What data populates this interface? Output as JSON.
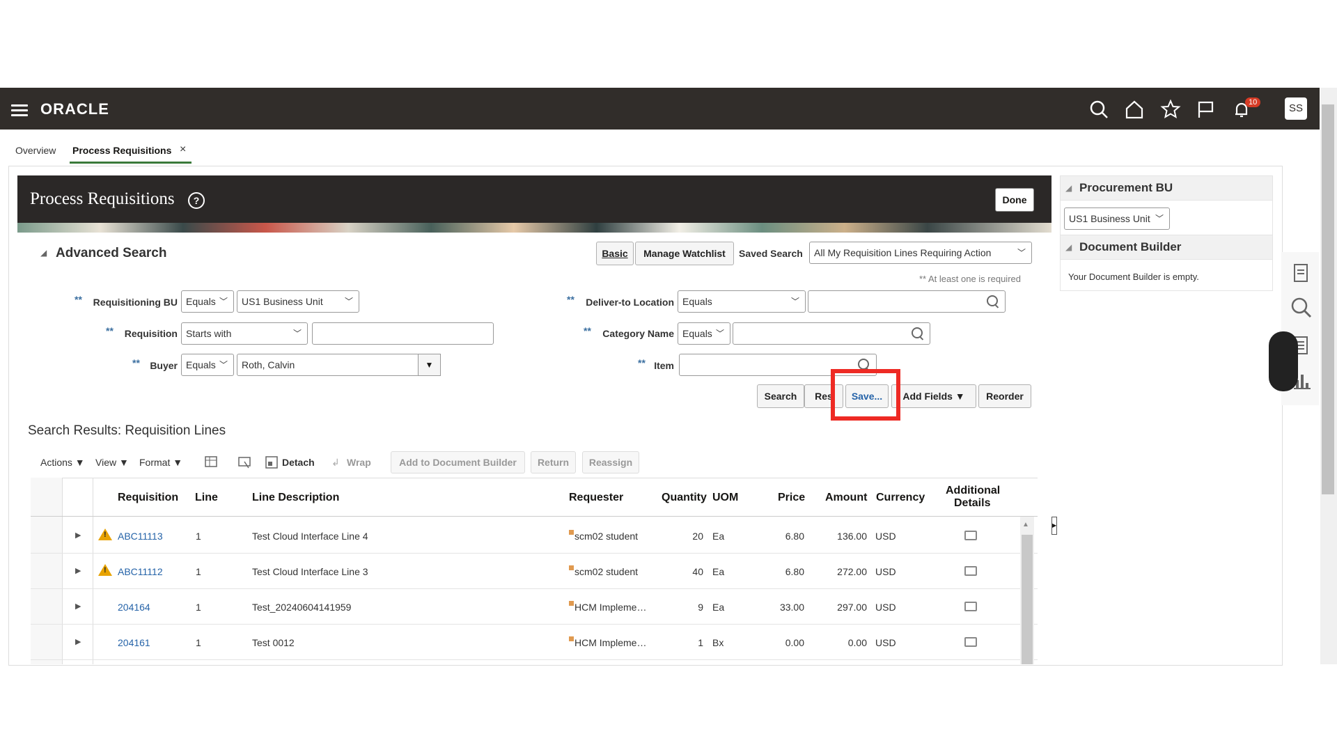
{
  "app": {
    "brand": "ORACLE",
    "user_initials": "SS",
    "notification_count": "10"
  },
  "tabs": [
    {
      "label": "Overview"
    },
    {
      "label": "Process Requisitions"
    }
  ],
  "header": {
    "title": "Process Requisitions",
    "done_label": "Done"
  },
  "advanced_search": {
    "title": "Advanced Search",
    "basic_label": "Basic",
    "watchlist_label": "Manage Watchlist",
    "saved_search_label": "Saved Search",
    "saved_search_value": "All My Requisition Lines Requiring Action",
    "required_note": "** At least one is required",
    "fields": {
      "req_bu": {
        "label": "Requisitioning BU",
        "operator": "Equals",
        "value": "US1 Business Unit"
      },
      "requisition": {
        "label": "Requisition",
        "operator": "Starts with",
        "value": ""
      },
      "buyer": {
        "label": "Buyer",
        "operator": "Equals",
        "value": "Roth, Calvin"
      },
      "deliver_to": {
        "label": "Deliver-to Location",
        "operator": "Equals",
        "value": ""
      },
      "category": {
        "label": "Category Name",
        "operator": "Equals",
        "value": ""
      },
      "item": {
        "label": "Item",
        "value": ""
      }
    },
    "required_marker": "**",
    "buttons": {
      "search": "Search",
      "reset": "Res",
      "save": "Save...",
      "add_fields": "Add Fields",
      "reorder": "Reorder"
    }
  },
  "results": {
    "title": "Search Results: Requisition Lines",
    "toolbar": {
      "actions": "Actions",
      "view": "View",
      "format": "Format",
      "detach": "Detach",
      "wrap": "Wrap",
      "add_doc": "Add to Document Builder",
      "return": "Return",
      "reassign": "Reassign"
    },
    "columns": [
      "Requisition",
      "Line",
      "Line Description",
      "Requester",
      "Quantity",
      "UOM",
      "Price",
      "Amount",
      "Currency",
      "Additional",
      "Details"
    ],
    "rows": [
      {
        "requisition": "ABC11113",
        "line": "1",
        "description": "Test Cloud Interface Line 4",
        "requester": "scm02 student",
        "quantity": "20",
        "uom": "Ea",
        "price": "6.80",
        "amount": "136.00",
        "currency": "USD"
      },
      {
        "requisition": "ABC11112",
        "line": "1",
        "description": "Test Cloud Interface Line 3",
        "requester": "scm02 student",
        "quantity": "40",
        "uom": "Ea",
        "price": "6.80",
        "amount": "272.00",
        "currency": "USD"
      },
      {
        "requisition": "204164",
        "line": "1",
        "description": "Test_20240604141959",
        "requester": "HCM Impleme…",
        "quantity": "9",
        "uom": "Ea",
        "price": "33.00",
        "amount": "297.00",
        "currency": "USD"
      },
      {
        "requisition": "204161",
        "line": "1",
        "description": "Test 0012",
        "requester": "HCM Impleme…",
        "quantity": "1",
        "uom": "Bx",
        "price": "0.00",
        "amount": "0.00",
        "currency": "USD"
      }
    ]
  },
  "right_panel": {
    "procurement_bu_title": "Procurement BU",
    "procurement_bu_value": "US1 Business Unit",
    "doc_builder_title": "Document Builder",
    "doc_builder_empty": "Your Document Builder is empty."
  },
  "colors": {
    "topbar": "#312d2a",
    "highlight": "#ee2a24",
    "link": "#2563a8"
  }
}
